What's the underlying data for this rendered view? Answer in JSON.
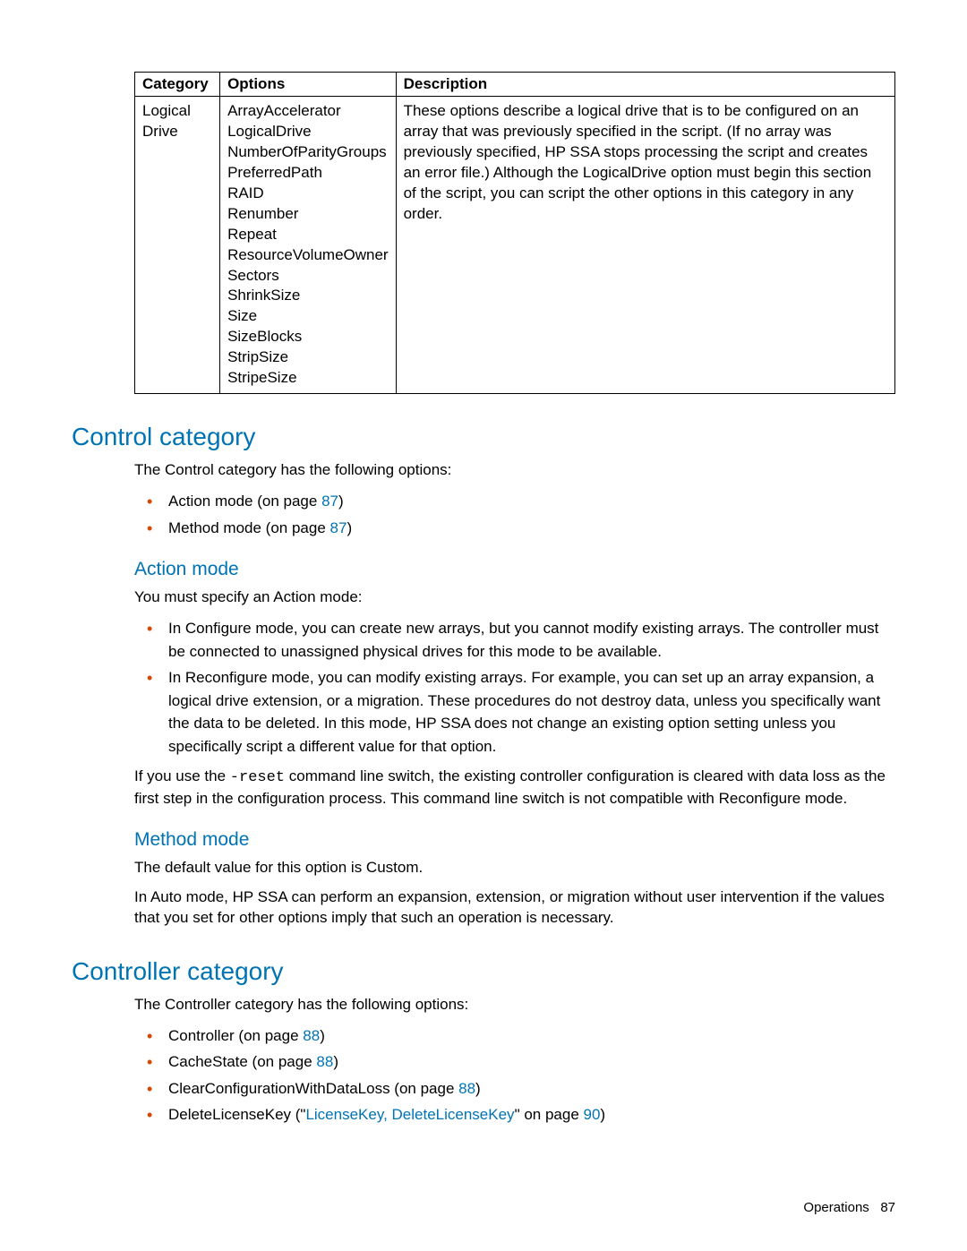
{
  "table": {
    "headers": {
      "category": "Category",
      "options": "Options",
      "description": "Description"
    },
    "row": {
      "category": "Logical Drive",
      "options": "ArrayAccelerator\nLogicalDrive\nNumberOfParityGroups\nPreferredPath\nRAID\nRenumber\nRepeat\nResourceVolumeOwner\nSectors\nShrinkSize\nSize\nSizeBlocks\nStripSize\nStripeSize",
      "description": "These options describe a logical drive that is to be configured on an array that was previously specified in the script. (If no array was previously specified, HP SSA stops processing the script and creates an error file.) Although the LogicalDrive option must begin this section of the script, you can script the other options in this category in any order."
    }
  },
  "sections": {
    "control": {
      "title": "Control category",
      "intro": "The Control category has the following options:",
      "bullets": {
        "b1a": "Action mode (on page ",
        "b1p": "87",
        "b1b": ")",
        "b2a": "Method mode (on page ",
        "b2p": "87",
        "b2b": ")"
      }
    },
    "action": {
      "title": "Action mode",
      "p1": "You must specify an Action mode:",
      "b1": "In Configure mode, you can create new arrays, but you cannot modify existing arrays. The controller must be connected to unassigned physical drives for this mode to be available.",
      "b2": "In Reconfigure mode, you can modify existing arrays. For example, you can set up an array expansion, a logical drive extension, or a migration. These procedures do not destroy data, unless you specifically want the data to be deleted. In this mode, HP SSA does not change an existing option setting unless you specifically script a different value for that option.",
      "p2a": "If you use the ",
      "p2code": "-reset",
      "p2b": " command line switch, the existing controller configuration is cleared with data loss as the first step in the configuration process. This command line switch is not compatible with Reconfigure mode."
    },
    "method": {
      "title": "Method mode",
      "p1": "The default value for this option is Custom.",
      "p2": "In Auto mode, HP SSA can perform an expansion, extension, or migration without user intervention if the values that you set for other options imply that such an operation is necessary."
    },
    "controller": {
      "title": "Controller category",
      "intro": "The Controller category has the following options:",
      "b1a": "Controller (on page ",
      "b1p": "88",
      "b1b": ")",
      "b2a": "CacheState (on page ",
      "b2p": "88",
      "b2b": ")",
      "b3a": "ClearConfigurationWithDataLoss (on page ",
      "b3p": "88",
      "b3b": ")",
      "b4a": "DeleteLicenseKey (\"",
      "b4link": "LicenseKey, DeleteLicenseKey",
      "b4b": "\" on page ",
      "b4p": "90",
      "b4c": ")"
    }
  },
  "footer": {
    "label": "Operations",
    "page": "87"
  }
}
